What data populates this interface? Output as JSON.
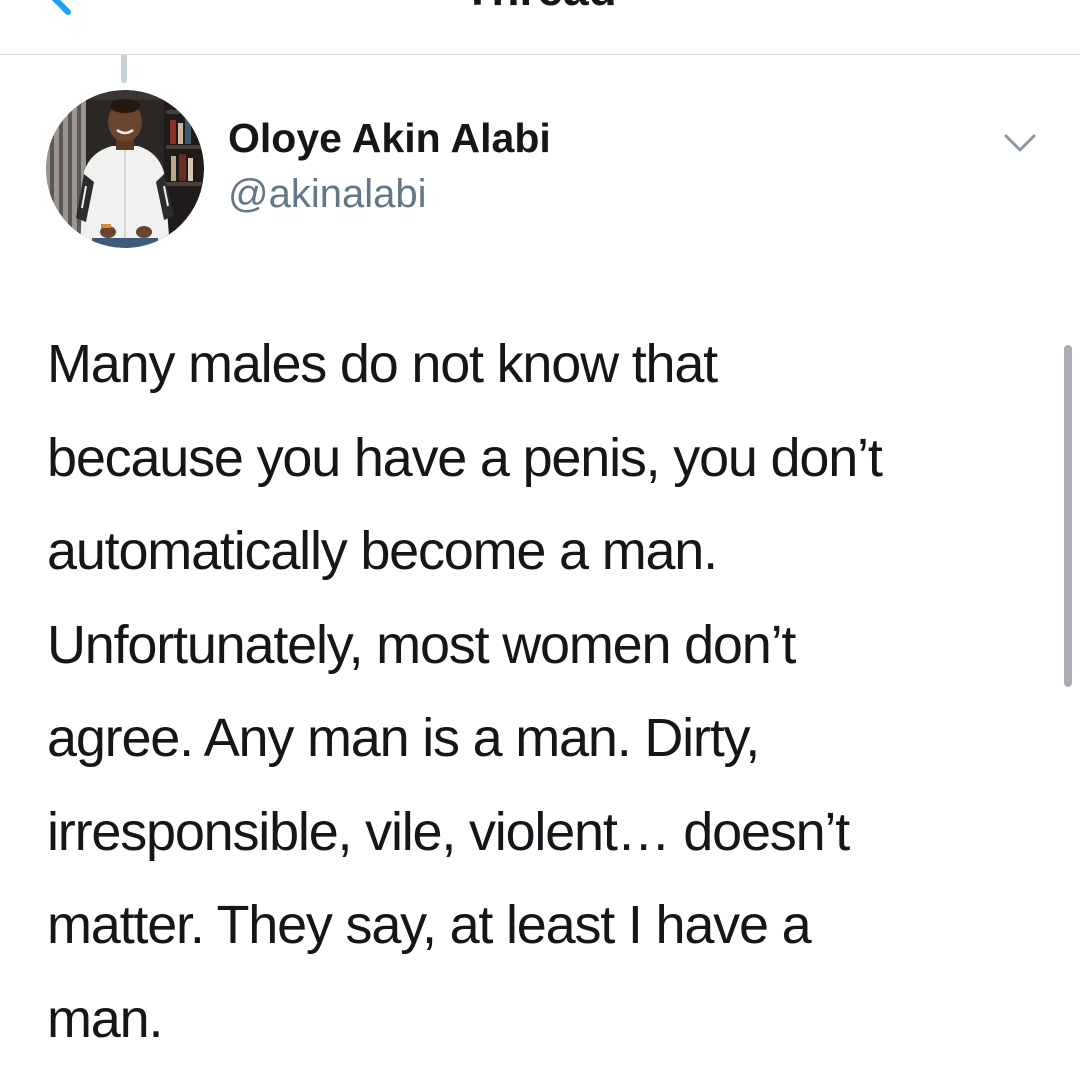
{
  "nav": {
    "title": "Thread",
    "back_icon": "chevron-left-icon"
  },
  "tweet": {
    "author": {
      "display_name": "Oloye Akin Alabi",
      "handle": "@akinalabi"
    },
    "more_icon": "chevron-down-icon",
    "text_lines": [
      "Many males do not know that",
      "because you have a penis, you don’t",
      "automatically become a man.",
      "Unfortunately, most women don’t",
      "agree. Any man is a man. Dirty,",
      "irresponsible, vile, violent… doesn’t",
      "matter. They say, at least I have a",
      "man."
    ]
  },
  "colors": {
    "text_primary": "#14171a",
    "text_secondary": "#657786",
    "accent": "#1da1f2",
    "divider": "#d6d9dc",
    "background": "#ffffff"
  }
}
